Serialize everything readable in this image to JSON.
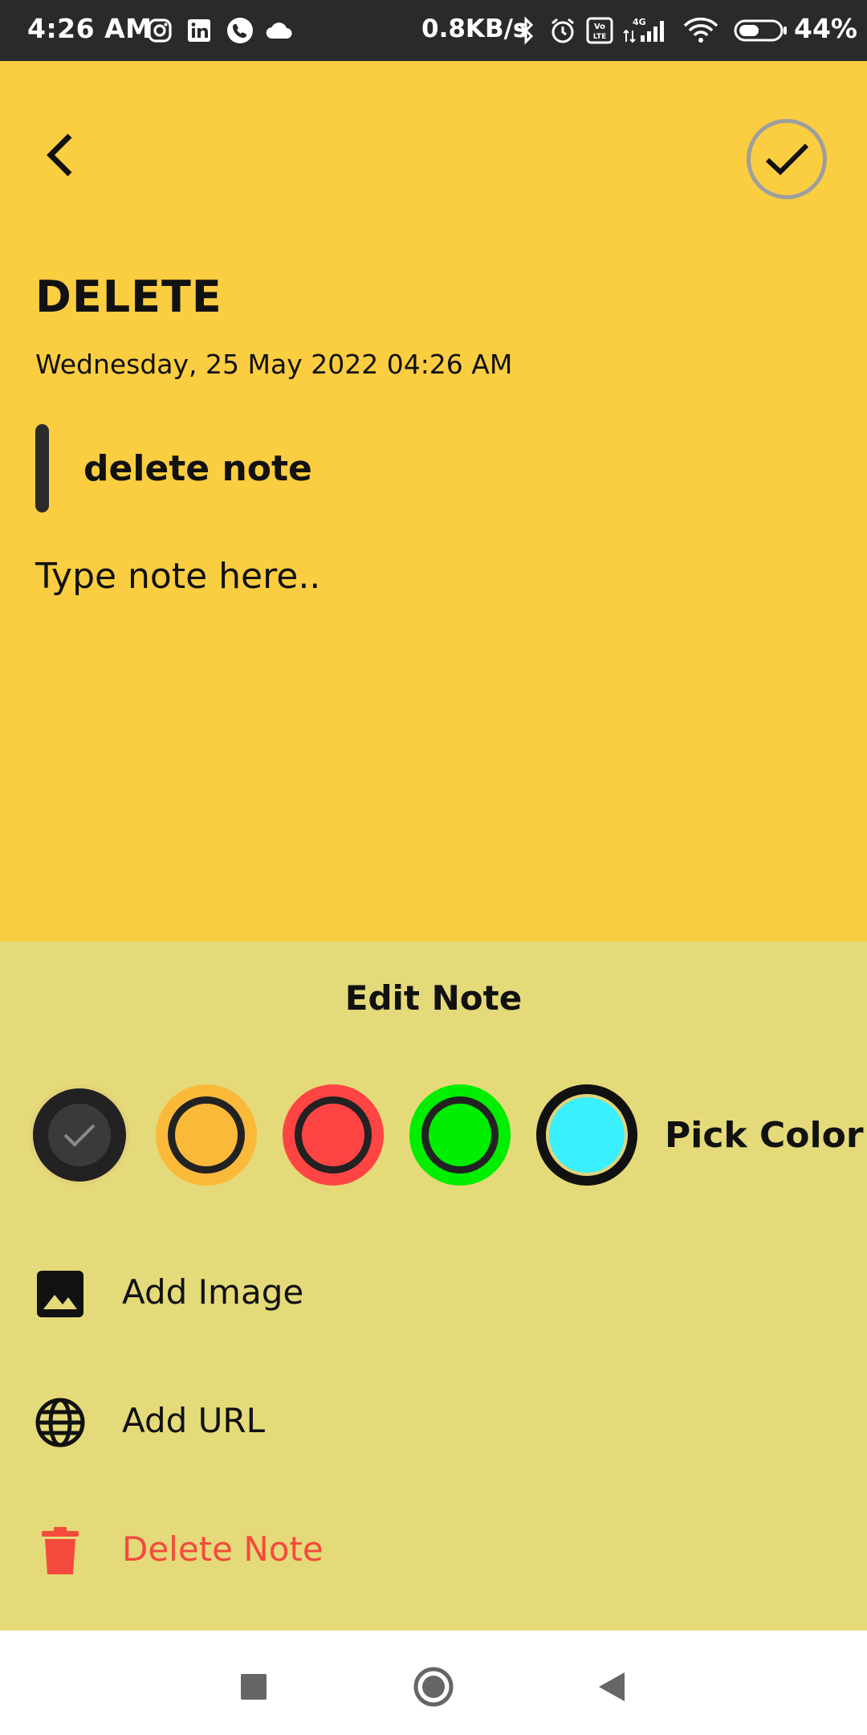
{
  "status_bar": {
    "time": "4:26 AM",
    "net_speed": "0.8KB/s",
    "battery_pct": "44%",
    "icons": [
      "instagram-icon",
      "linkedin-icon",
      "whatsapp-icon",
      "cloud-icon",
      "bluetooth-icon",
      "alarm-icon",
      "volte-icon",
      "signal-icon",
      "wifi-icon",
      "battery-icon"
    ]
  },
  "note": {
    "title": "DELETE",
    "datetime": "Wednesday, 25 May 2022 04:26 AM",
    "subtitle": "delete note",
    "body_placeholder": "Type note here..",
    "background_color": "#fbcd40"
  },
  "sheet": {
    "title": "Edit Note",
    "pick_color_label": "Pick Color",
    "colors": [
      {
        "name": "dark",
        "hex": "#333333",
        "selected": true
      },
      {
        "name": "orange",
        "hex": "#fbb93a",
        "selected": false
      },
      {
        "name": "red",
        "hex": "#ff4444",
        "selected": false
      },
      {
        "name": "green",
        "hex": "#00ee00",
        "selected": false
      },
      {
        "name": "cyan",
        "hex": "#3af0ff",
        "selected": false
      }
    ],
    "options": [
      {
        "label": "Add Image",
        "icon": "image-icon"
      },
      {
        "label": "Add URL",
        "icon": "globe-icon"
      },
      {
        "label": "Delete Note",
        "icon": "trash-icon",
        "color": "#f44a3e"
      }
    ],
    "background_color": "#e4da79"
  },
  "nav": {
    "buttons": [
      "recents-button",
      "home-button",
      "back-button"
    ]
  }
}
